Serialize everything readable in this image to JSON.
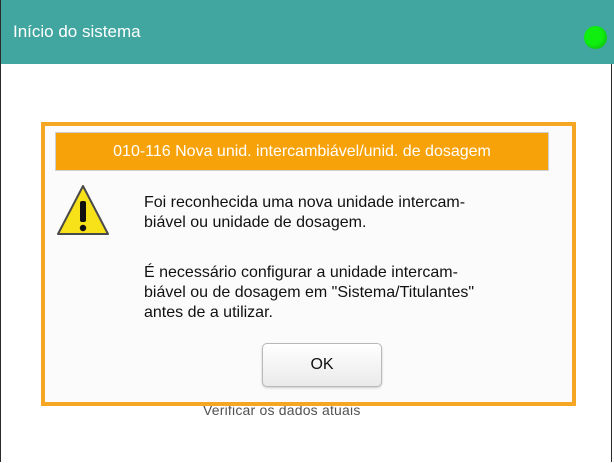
{
  "window": {
    "title": "Início do sistema",
    "status_color": "#10ee10"
  },
  "background": {
    "partial_text": "Verificar os dados atuais"
  },
  "dialog": {
    "header": "010-116 Nova unid. intercambiável/unid. de dosagem",
    "icon": "warning-icon",
    "message1_line1": "Foi reconhecida uma nova unidade intercam-",
    "message1_line2": "biável ou unidade de dosagem.",
    "message2_line1": "É necessário configurar a unidade intercam-",
    "message2_line2": "biável ou de dosagem em \"Sistema/Titulantes\"",
    "message2_line3": "antes de a utilizar.",
    "ok_label": "OK"
  },
  "colors": {
    "titlebar": "#41a6a0",
    "dialog_border": "#f5a623",
    "dialog_header": "#f8a20a"
  }
}
